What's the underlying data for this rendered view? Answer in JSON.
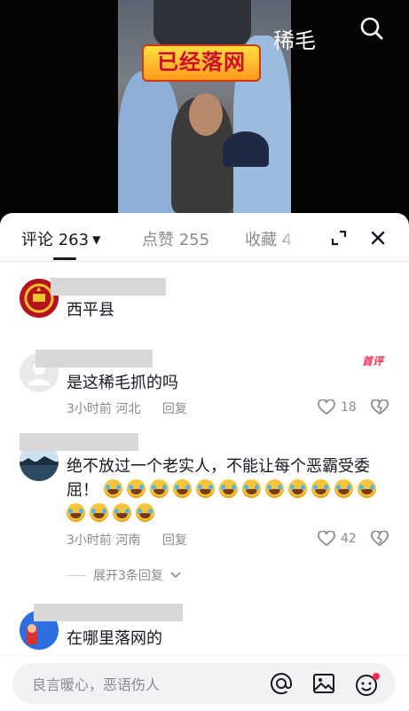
{
  "video": {
    "title": "稀毛",
    "caption_stamp": "已经落网"
  },
  "tabs": {
    "comments_label": "评论 263",
    "likes_label": "点赞 255",
    "favorites_label": "收藏 4"
  },
  "comments": [
    {
      "text": "西平县",
      "avatar": "emblem-avatar"
    },
    {
      "text": "是这稀毛抓的吗",
      "badge": "首评",
      "time": "3小时前",
      "location": "河北",
      "reply_label": "回复",
      "likes": "18"
    },
    {
      "text": "绝不放过一个老实人，不能让每个恶霸受委屈！",
      "emoji_count": 16,
      "time": "3小时前",
      "location": "河南",
      "reply_label": "回复",
      "likes": "42",
      "expand_replies": "展开3条回复"
    },
    {
      "text": "在哪里落网的"
    }
  ],
  "input": {
    "placeholder": "良言暖心，恶语伤人"
  }
}
